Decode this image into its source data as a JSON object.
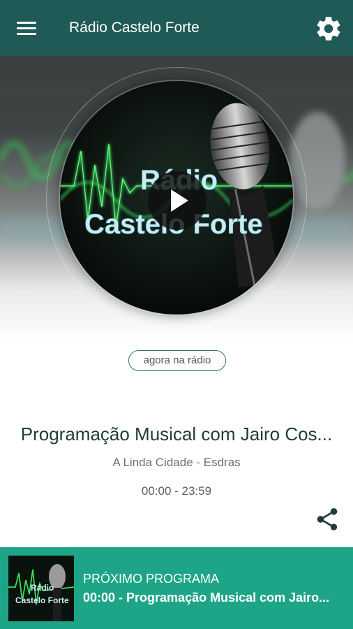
{
  "app": {
    "title": "Rádio Castelo Forte",
    "accent_color": "#1f5a57",
    "icons": [
      "menu-icon",
      "gear-icon",
      "play-icon",
      "share-icon"
    ]
  },
  "cover": {
    "logo_line1": "Rádio",
    "logo_line2": "Castelo Forte"
  },
  "now_playing": {
    "badge": "agora na rádio",
    "program_title": "Programação Musical com Jairo Cos...",
    "subtitle": "A Linda Cidade - Esdras",
    "time": "00:00 - 23:59"
  },
  "next_program": {
    "label": "PRÓXIMO PROGRAMA",
    "text": "00:00 - Programação Musical com Jairo...",
    "bar_color": "#1ea587"
  }
}
